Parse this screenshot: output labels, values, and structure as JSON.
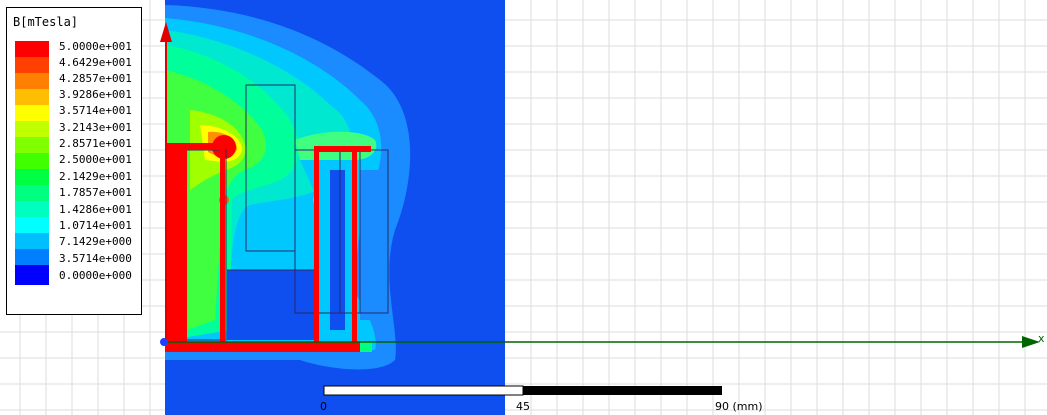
{
  "legend": {
    "title": "B[mTesla]",
    "entries": [
      {
        "label": "5.0000e+001",
        "color": "#ff0000"
      },
      {
        "label": "4.6429e+001",
        "color": "#ff4000"
      },
      {
        "label": "4.2857e+001",
        "color": "#ff8000"
      },
      {
        "label": "3.9286e+001",
        "color": "#ffbf00"
      },
      {
        "label": "3.5714e+001",
        "color": "#ffff00"
      },
      {
        "label": "3.2143e+001",
        "color": "#bfff00"
      },
      {
        "label": "2.8571e+001",
        "color": "#80ff00"
      },
      {
        "label": "2.5000e+001",
        "color": "#40ff00"
      },
      {
        "label": "2.1429e+001",
        "color": "#00ff40"
      },
      {
        "label": "1.7857e+001",
        "color": "#00ff80"
      },
      {
        "label": "1.4286e+001",
        "color": "#00ffbf"
      },
      {
        "label": "1.0714e+001",
        "color": "#00ffff"
      },
      {
        "label": "7.1429e+000",
        "color": "#00bfff"
      },
      {
        "label": "3.5714e+000",
        "color": "#0080ff"
      },
      {
        "label": "0.0000e+000",
        "color": "#0000ff"
      }
    ]
  },
  "scale_bar": {
    "tick_0": "0",
    "tick_1": "45",
    "tick_2": "90 (mm)"
  },
  "axes": {
    "x_label": "x"
  },
  "colors": {
    "field_background": "#0f4ff0",
    "conductor": "#ff0000",
    "x_axis": "#006400",
    "y_axis": "#e00000",
    "grid": "#dcdcdc"
  }
}
